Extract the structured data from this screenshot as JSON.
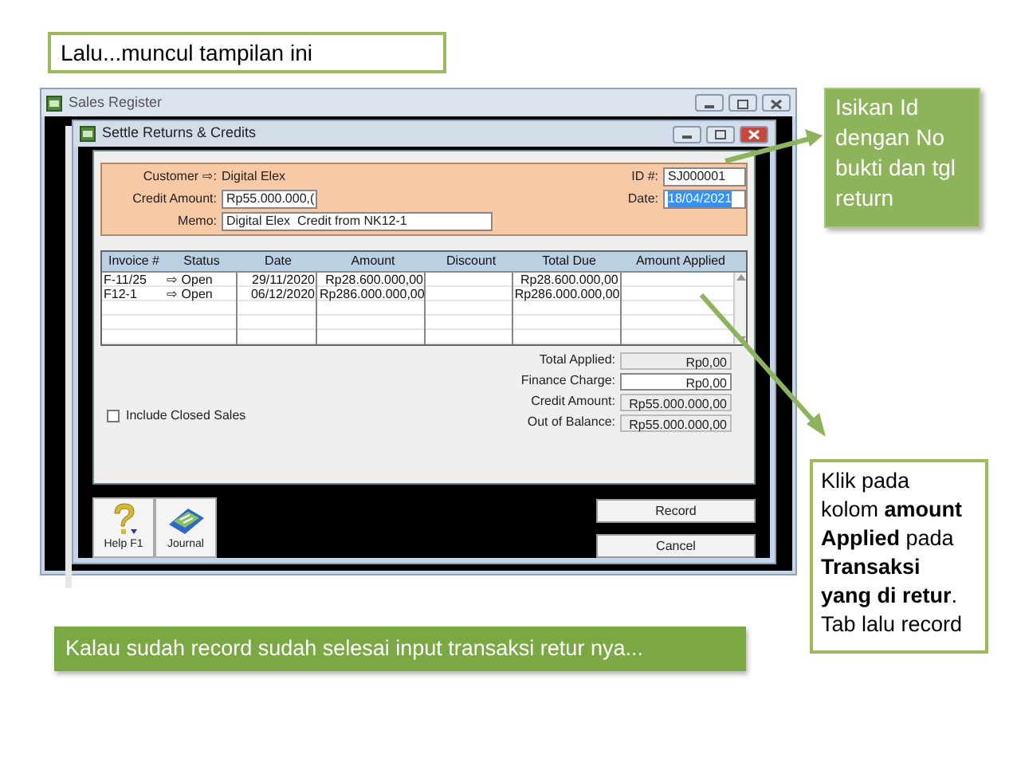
{
  "slide_title": "Lalu...muncul tampilan ini",
  "outer_window": {
    "title": "Sales Register"
  },
  "dialog": {
    "title": "Settle Returns & Credits",
    "header": {
      "customer_label": "Customer ⇨:",
      "customer": "Digital Elex",
      "credit_amount_label": "Credit Amount:",
      "credit_amount": "Rp55.000.000,(",
      "memo_label": "Memo:",
      "memo": "Digital Elex  Credit from NK12-1",
      "id_label": "ID #:",
      "id": "SJ000001",
      "date_label": "Date:",
      "date": "18/04/2021",
      "date_selected": true
    },
    "table": {
      "columns": [
        "Invoice #",
        "Status",
        "Date",
        "Amount",
        "Discount",
        "Total Due",
        "Amount Applied"
      ],
      "rows": [
        [
          "F-11/25",
          "⇨ Open",
          "29/11/2020",
          "Rp28.600.000,00",
          "",
          "Rp28.600.000,00",
          ""
        ],
        [
          "F12-1",
          "⇨ Open",
          "06/12/2020",
          "Rp286.000.000,00",
          "",
          "Rp286.000.000,00",
          ""
        ]
      ]
    },
    "totals": [
      {
        "label": "Total Applied:",
        "value": "Rp0,00",
        "editable": false
      },
      {
        "label": "Finance Charge:",
        "value": "Rp0,00",
        "editable": true
      },
      {
        "label": "Credit Amount:",
        "value": "Rp55.000.000,00",
        "editable": false
      },
      {
        "label": "Out of Balance:",
        "value": "Rp55.000.000,00",
        "editable": false
      }
    ],
    "include_closed_sales": {
      "label": "Include Closed Sales",
      "checked": false
    },
    "tool_buttons": [
      {
        "label": "Help F1",
        "kind": "help"
      },
      {
        "label": "Journal",
        "kind": "journal"
      }
    ],
    "buttons": [
      "Record",
      "Cancel"
    ]
  },
  "callouts": [
    {
      "kind": "filled",
      "text": "Isikan Id dengan No bukti dan tgl return"
    },
    {
      "kind": "outlined",
      "text": "Klik pada kolom **amount Applied** pada **Transaksi yang di retur**. Tab lalu record"
    }
  ],
  "footer_banner": "Kalau sudah record sudah selesai input transaksi retur nya..."
}
